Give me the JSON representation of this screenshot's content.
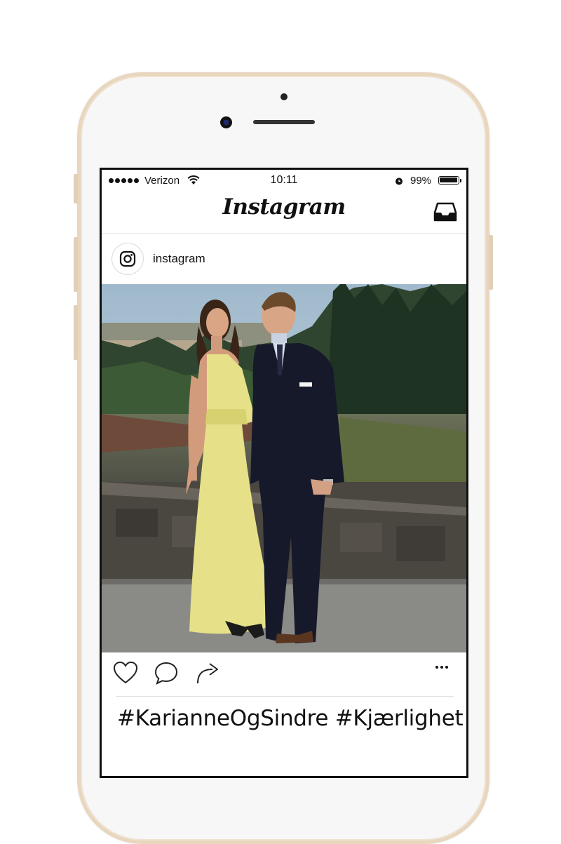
{
  "status_bar": {
    "carrier": "Verizon",
    "time": "10:11",
    "battery_percent": "99%",
    "battery_level": 0.99
  },
  "header": {
    "title": "Instagram",
    "inbox_icon": "inbox-tray-icon"
  },
  "post": {
    "username": "instagram",
    "avatar_icon": "instagram-camera-icon",
    "photo_alt": "photo",
    "actions": [
      "heart-icon",
      "comment-icon",
      "share-icon",
      "more-icon"
    ],
    "caption": "#KarianneOgSindre #Kjærlighet"
  },
  "colors": {
    "frame": "#e8d6bf",
    "text": "#111111",
    "divider": "#dedede"
  }
}
